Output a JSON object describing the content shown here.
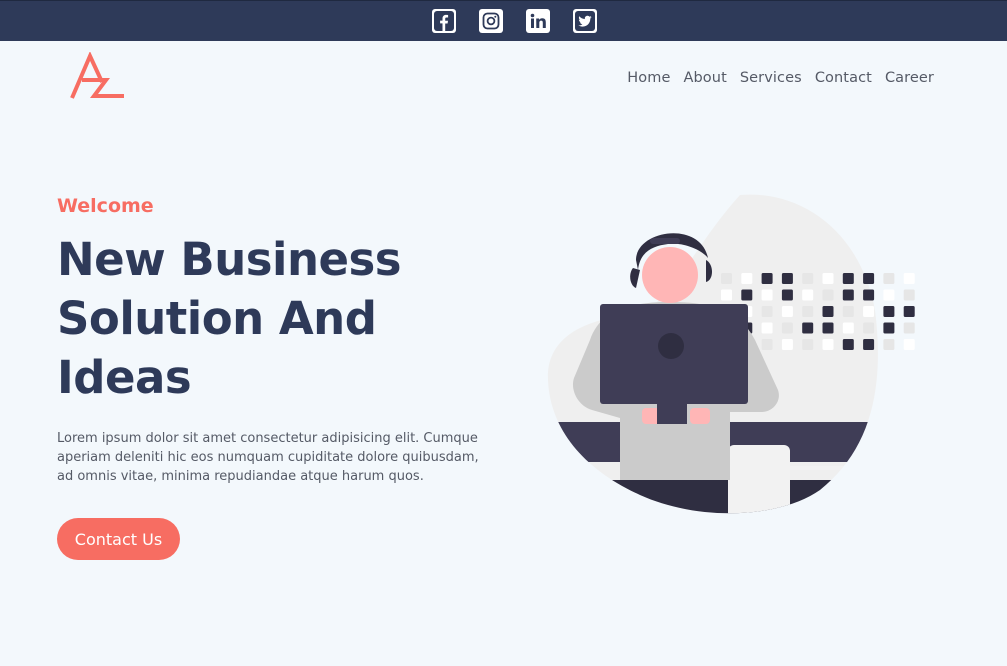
{
  "social": {
    "icons": [
      {
        "name": "facebook-icon",
        "label": "f"
      },
      {
        "name": "instagram-icon"
      },
      {
        "name": "linkedin-icon",
        "label": "in"
      },
      {
        "name": "twitter-icon"
      }
    ],
    "bar_color": "#2e3a59"
  },
  "nav": {
    "items": [
      "Home",
      "About",
      "Services",
      "Contact",
      "Career"
    ]
  },
  "hero": {
    "eyebrow": "Welcome",
    "headline_lines": [
      "New Business",
      "Solution And",
      "Ideas"
    ],
    "body": "Lorem ipsum dolor sit amet consectetur adipisicing elit. Cumque aperiam deleniti hic eos numquam cupiditate dolore quibusdam, ad omnis vitae, minima repudiandae atque harum quos.",
    "cta_label": "Contact Us"
  },
  "colors": {
    "accent": "#f76d62",
    "navy": "#2e3a59",
    "background": "#f3f8fc"
  }
}
